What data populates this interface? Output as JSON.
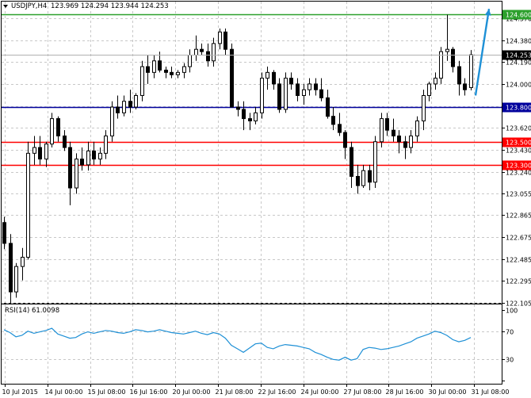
{
  "header": {
    "symbol_label": "USDJPY,H4",
    "ohlc_label": "123.969 124.294 123.944 124.253"
  },
  "chart_data": {
    "type": "candlestick",
    "symbol": "USDJPY",
    "timeframe": "H4",
    "ohlc_current": {
      "open": 123.969,
      "high": 124.294,
      "low": 123.944,
      "close": 124.253
    },
    "price_axis": {
      "range": [
        122.105,
        124.72
      ],
      "ticks": [
        "124.570",
        "124.380",
        "124.190",
        "124.000",
        "123.810",
        "123.620",
        "123.430",
        "123.240",
        "123.055",
        "122.865",
        "122.675",
        "122.485",
        "122.295",
        "122.105"
      ]
    },
    "time_axis_labels": [
      "10 Jul 2015",
      "14 Jul 00:00",
      "15 Jul 08:00",
      "16 Jul 16:00",
      "20 Jul 00:00",
      "21 Jul 08:00",
      "22 Jul 16:00",
      "24 Jul 00:00",
      "27 Jul 08:00",
      "28 Jul 16:00",
      "30 Jul 00:00",
      "31 Jul 08:00"
    ],
    "current_price": {
      "value": 124.253,
      "label": "124.253",
      "color": "#000000"
    },
    "horizontal_levels": [
      {
        "value": 124.6,
        "label": "124.600",
        "color": "#2ca02c"
      },
      {
        "value": 123.8,
        "label": "123.800",
        "color": "#00009c"
      },
      {
        "value": 123.5,
        "label": "123.500",
        "color": "#ff0000"
      },
      {
        "value": 123.3,
        "label": "123.300",
        "color": "#ff0000"
      }
    ],
    "arrow": {
      "color": "#1e90d6",
      "from_price": 123.9,
      "to_price": 124.65
    },
    "candles": [
      [
        122.8,
        122.85,
        122.57,
        122.62
      ],
      [
        122.62,
        122.7,
        122.1,
        122.2
      ],
      [
        122.2,
        122.45,
        122.15,
        122.42
      ],
      [
        122.42,
        122.58,
        122.3,
        122.5
      ],
      [
        122.5,
        123.5,
        122.48,
        123.4
      ],
      [
        123.4,
        123.55,
        123.3,
        123.45
      ],
      [
        123.45,
        123.55,
        123.3,
        123.35
      ],
      [
        123.35,
        123.5,
        123.28,
        123.48
      ],
      [
        123.48,
        123.75,
        123.45,
        123.7
      ],
      [
        123.7,
        123.72,
        123.5,
        123.55
      ],
      [
        123.55,
        123.6,
        123.42,
        123.45
      ],
      [
        123.45,
        123.5,
        122.95,
        123.1
      ],
      [
        123.1,
        123.4,
        123.05,
        123.35
      ],
      [
        123.35,
        123.45,
        123.25,
        123.3
      ],
      [
        123.3,
        123.5,
        123.25,
        123.42
      ],
      [
        123.42,
        123.5,
        123.3,
        123.35
      ],
      [
        123.35,
        123.45,
        123.3,
        123.4
      ],
      [
        123.4,
        123.6,
        123.35,
        123.55
      ],
      [
        123.55,
        123.85,
        123.5,
        123.8
      ],
      [
        123.8,
        123.9,
        123.7,
        123.75
      ],
      [
        123.75,
        123.9,
        123.72,
        123.85
      ],
      [
        123.85,
        123.95,
        123.75,
        123.8
      ],
      [
        123.8,
        123.92,
        123.78,
        123.9
      ],
      [
        123.9,
        124.2,
        123.85,
        124.15
      ],
      [
        124.15,
        124.25,
        124.0,
        124.1
      ],
      [
        124.1,
        124.25,
        124.05,
        124.2
      ],
      [
        124.2,
        124.28,
        124.1,
        124.12
      ],
      [
        124.12,
        124.15,
        124.05,
        124.1
      ],
      [
        124.1,
        124.15,
        124.05,
        124.08
      ],
      [
        124.08,
        124.12,
        124.05,
        124.1
      ],
      [
        124.1,
        124.18,
        124.05,
        124.15
      ],
      [
        124.15,
        124.3,
        124.1,
        124.25
      ],
      [
        124.25,
        124.42,
        124.2,
        124.3
      ],
      [
        124.3,
        124.35,
        124.25,
        124.28
      ],
      [
        124.28,
        124.35,
        124.15,
        124.2
      ],
      [
        124.2,
        124.4,
        124.15,
        124.35
      ],
      [
        124.35,
        124.48,
        124.3,
        124.45
      ],
      [
        124.45,
        124.48,
        124.25,
        124.3
      ],
      [
        124.3,
        124.35,
        123.9,
        123.8
      ],
      [
        123.8,
        123.85,
        123.72,
        123.78
      ],
      [
        123.78,
        123.85,
        123.6,
        123.7
      ],
      [
        123.7,
        123.75,
        123.6,
        123.68
      ],
      [
        123.68,
        123.8,
        123.65,
        123.75
      ],
      [
        123.75,
        124.1,
        123.7,
        124.05
      ],
      [
        124.05,
        124.15,
        123.95,
        124.1
      ],
      [
        124.1,
        124.12,
        123.95,
        124.0
      ],
      [
        124.0,
        124.05,
        123.75,
        123.78
      ],
      [
        123.78,
        124.1,
        123.75,
        124.05
      ],
      [
        124.05,
        124.1,
        123.95,
        124.0
      ],
      [
        124.0,
        124.05,
        123.85,
        123.9
      ],
      [
        123.9,
        124.0,
        123.82,
        123.95
      ],
      [
        123.95,
        124.05,
        123.9,
        124.0
      ],
      [
        124.0,
        124.05,
        123.9,
        123.95
      ],
      [
        123.95,
        124.05,
        123.85,
        123.88
      ],
      [
        123.88,
        123.95,
        123.7,
        123.72
      ],
      [
        123.72,
        123.8,
        123.6,
        123.65
      ],
      [
        123.65,
        123.75,
        123.55,
        123.58
      ],
      [
        123.58,
        123.6,
        123.35,
        123.45
      ],
      [
        123.45,
        123.5,
        123.1,
        123.2
      ],
      [
        123.2,
        123.3,
        123.05,
        123.12
      ],
      [
        123.12,
        123.3,
        123.1,
        123.25
      ],
      [
        123.25,
        123.3,
        123.08,
        123.15
      ],
      [
        123.15,
        123.55,
        123.1,
        123.5
      ],
      [
        123.5,
        123.75,
        123.45,
        123.7
      ],
      [
        123.7,
        123.75,
        123.55,
        123.6
      ],
      [
        123.6,
        123.7,
        123.5,
        123.55
      ],
      [
        123.55,
        123.6,
        123.4,
        123.5
      ],
      [
        123.5,
        123.55,
        123.35,
        123.45
      ],
      [
        123.45,
        123.6,
        123.4,
        123.55
      ],
      [
        123.55,
        123.72,
        123.5,
        123.68
      ],
      [
        123.68,
        123.95,
        123.6,
        123.9
      ],
      [
        123.9,
        124.02,
        123.85,
        124.0
      ],
      [
        124.0,
        124.1,
        123.95,
        124.05
      ],
      [
        124.05,
        124.32,
        124.0,
        124.28
      ],
      [
        124.28,
        124.6,
        124.2,
        124.3
      ],
      [
        124.3,
        124.32,
        124.1,
        124.15
      ],
      [
        124.15,
        124.2,
        123.9,
        124.0
      ],
      [
        124.0,
        124.05,
        123.9,
        123.95
      ],
      [
        123.969,
        124.294,
        123.944,
        124.253
      ]
    ]
  },
  "rsi": {
    "label": "RSI(14) 61.0098",
    "period": 14,
    "value": 61.0098,
    "range": [
      0,
      100
    ],
    "ticks": [
      "100",
      "70",
      "30",
      "0"
    ],
    "levels": [
      70,
      30
    ],
    "line_color": "#1e90d6",
    "values": [
      72,
      68,
      62,
      64,
      70,
      67,
      69,
      71,
      74,
      66,
      63,
      60,
      61,
      66,
      69,
      67,
      69,
      71,
      70,
      68,
      67,
      69,
      72,
      71,
      69,
      70,
      72,
      70,
      68,
      67,
      66,
      68,
      70,
      67,
      65,
      68,
      66,
      60,
      50,
      45,
      40,
      46,
      52,
      53,
      47,
      45,
      49,
      51,
      50,
      49,
      47,
      45,
      40,
      37,
      33,
      30,
      29,
      33,
      29,
      31,
      44,
      47,
      46,
      44,
      45,
      47,
      49,
      52,
      55,
      60,
      63,
      66,
      70,
      68,
      64,
      58,
      55,
      57,
      61
    ]
  }
}
